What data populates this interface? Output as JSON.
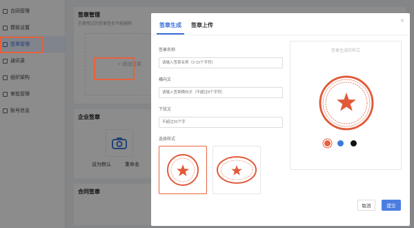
{
  "sidebar": {
    "items": [
      {
        "label": "合同管理"
      },
      {
        "label": "模板设置"
      },
      {
        "label": "签章管理"
      },
      {
        "label": "通讯录"
      },
      {
        "label": "组织架构"
      },
      {
        "label": "审批管理"
      },
      {
        "label": "账号信息"
      }
    ]
  },
  "main": {
    "title": "签章管理",
    "subtitle": "已使用过的签章签名不能删除",
    "add_label": "+ 添加签章",
    "enterprise_label": "企业签章",
    "shortcut_label": "设为默认",
    "shortcut_label2": "重命名",
    "contract_label": "合同签章"
  },
  "modal": {
    "tabs": [
      "签章生成",
      "签章上传"
    ],
    "close": "×",
    "fields": {
      "name_label": "签章名称",
      "name_placeholder": "请输入签章名称（2-15个字符）",
      "horizontal_label": "横向文",
      "horizontal_placeholder": "请输入签章横向文（不超过8个字符）",
      "lower_label": "下弦文",
      "lower_placeholder": "不超过20个字",
      "style_label": "选择样式"
    },
    "preview_label": "签章生成的样式",
    "colors": [
      "#e8603c",
      "#3b7bd8",
      "#111111"
    ],
    "seal_color": "#e05a3a",
    "buttons": {
      "cancel": "取消",
      "submit": "提交"
    }
  }
}
